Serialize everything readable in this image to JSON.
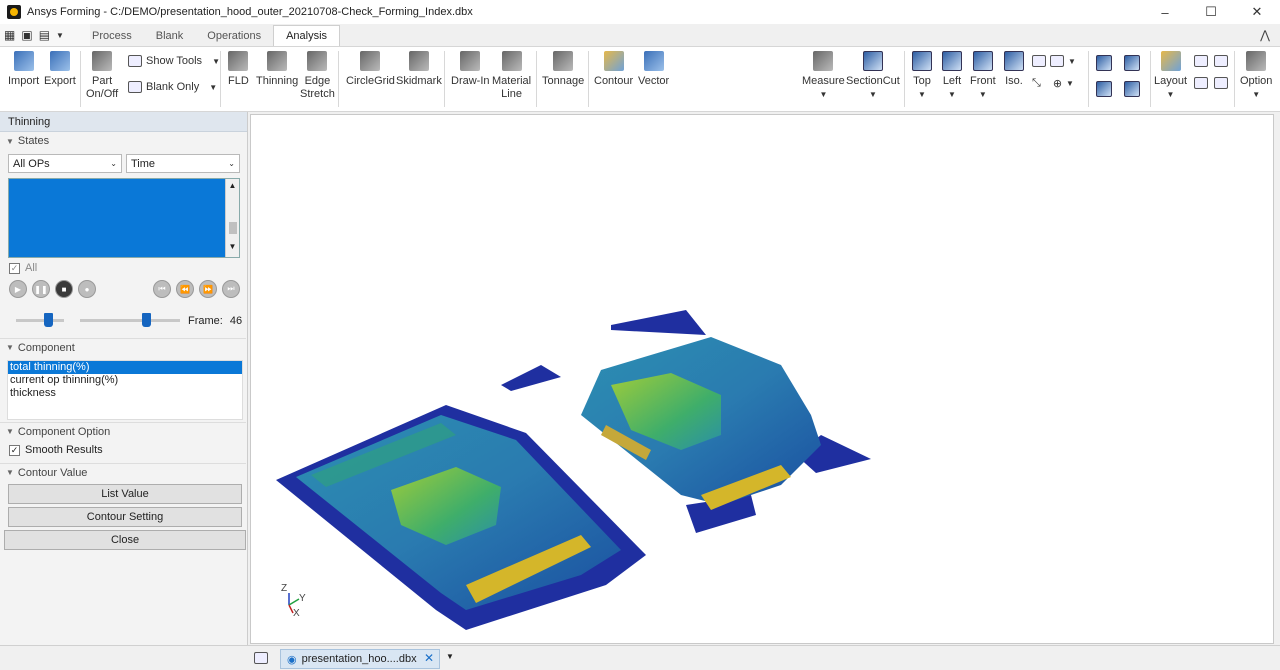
{
  "window": {
    "title": "Ansys Forming - C:/DEMO/presentation_hood_outer_20210708-Check_Forming_Index.dbx",
    "minimize": "–",
    "maximize": "☐",
    "close": "✕"
  },
  "tabs": [
    "Process",
    "Blank",
    "Operations",
    "Analysis"
  ],
  "ribbon": {
    "import": "Import",
    "export": "Export",
    "part_l1": "Part",
    "part_l2": "On/Off",
    "show_tools": "Show Tools",
    "blank_only": "Blank Only",
    "fld": "FLD",
    "thinning": "Thinning",
    "edge_l1": "Edge",
    "edge_l2": "Stretch",
    "circlegrid": "CircleGrid",
    "skidmark": "Skidmark",
    "drawin": "Draw-In",
    "material_l1": "Material",
    "material_l2": "Line",
    "tonnage": "Tonnage",
    "contour": "Contour",
    "vector": "Vector",
    "measure": "Measure",
    "sectioncut": "SectionCut",
    "top": "Top",
    "left": "Left",
    "front": "Front",
    "iso": "Iso.",
    "layout": "Layout",
    "option": "Option"
  },
  "panel": {
    "title": "Thinning",
    "states": "States",
    "combo_ops": "All OPs",
    "combo_time": "Time",
    "all_label": "All",
    "frame_label": "Frame:",
    "frame_value": "46",
    "component": "Component",
    "components": [
      "total thinning(%)",
      "current op thinning(%)",
      "thickness"
    ],
    "component_option": "Component Option",
    "smooth_results": "Smooth Results",
    "contour_value": "Contour Value",
    "list_value": "List Value",
    "contour_setting": "Contour Setting",
    "close": "Close"
  },
  "axes": {
    "z": "Z",
    "y": "Y",
    "x": "X"
  },
  "status": {
    "doc_tab": "presentation_hoo....dbx",
    "close_tab": "✕"
  }
}
